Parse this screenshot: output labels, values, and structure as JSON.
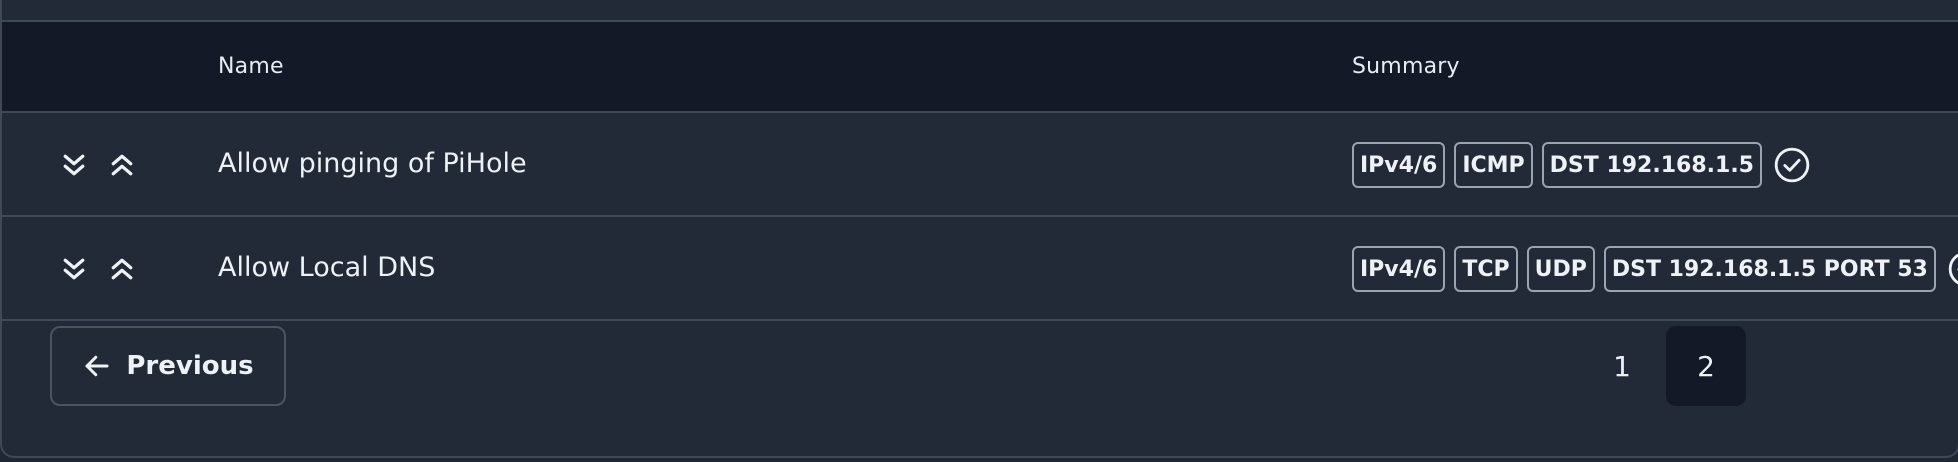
{
  "table": {
    "columns": {
      "name": "Name",
      "summary": "Summary"
    },
    "rows": [
      {
        "name": "Allow pinging of PiHole",
        "tags": [
          "IPv4/6",
          "ICMP",
          "DST 192.168.1.5"
        ],
        "status_icon": "check-circle-icon"
      },
      {
        "name": "Allow Local DNS",
        "tags": [
          "IPv4/6",
          "TCP",
          "UDP",
          "DST 192.168.1.5 PORT 53"
        ],
        "status_icon": "check-circle-icon"
      }
    ]
  },
  "pagination": {
    "previous_label": "Previous",
    "pages": [
      "1",
      "2"
    ],
    "current_page": "2"
  },
  "colors": {
    "background": "#222a38",
    "header_background": "#131927",
    "border": "#3e4858",
    "tag_border": "#9aa3b2",
    "text": "#eef1f5"
  }
}
